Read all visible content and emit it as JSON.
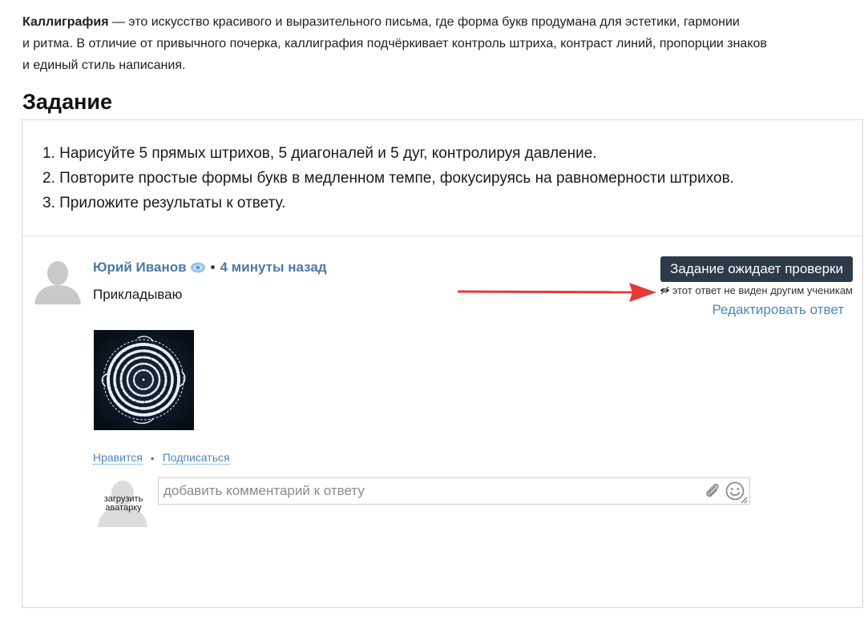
{
  "intro": {
    "term": "Каллиграфия",
    "text_line1": " — это искусство красивого и выразительного письма, где форма букв продумана для эстетики, гармонии",
    "text_line2": "и ритма. В отличие от привычного почерка, каллиграфия подчёркивает контроль штриха, контраст линий, пропорции знаков",
    "text_line3": "и единый стиль написания."
  },
  "section": {
    "title": "Задание"
  },
  "task": {
    "steps": [
      "1. Нарисуйте 5 прямых штрихов, 5 диагоналей и 5 дуг, контролируя давление.",
      "2. Повторите простые формы букв в медленном темпе, фокусируясь на равномерности штрихов.",
      "3. Приложите результаты к ответу."
    ]
  },
  "answer": {
    "author": "Юрий Иванов",
    "separator": "•",
    "time": "4 минуты назад",
    "text": "Прикладываю",
    "status_label": "Задание ожидает проверки",
    "hidden_note": "этот ответ не виден другим ученикам",
    "edit_label": "Редактировать ответ",
    "like_label": "Нравится",
    "action_separator": "•",
    "subscribe_label": "Подписаться"
  },
  "comment": {
    "avatar_label": "загрузить аватарку",
    "placeholder": "добавить комментарий к ответу"
  },
  "icons": {
    "avatar": "user-silhouette-icon",
    "badge": "speech-bubble-icon",
    "hidden": "eye-slash-icon",
    "attach": "paperclip-icon",
    "emoji": "smiley-icon",
    "resize": "resize-handle-icon"
  },
  "colors": {
    "accent_link": "#4a86be",
    "author": "#4a7aa6",
    "status_button": "#2c3b4a",
    "annotation_arrow": "#e53935"
  }
}
